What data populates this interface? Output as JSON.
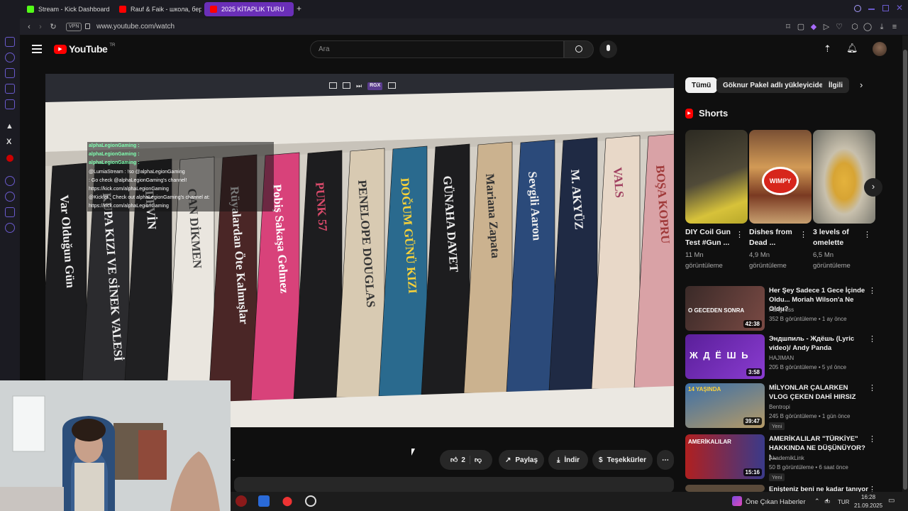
{
  "browser": {
    "tabs": [
      {
        "label": "Stream - Kick Dashboard",
        "color": "#53fc18"
      },
      {
        "label": "Rauf & Faik - школа, бер",
        "color": "#ff0000"
      },
      {
        "label": "2025 KİTAPLIK TURU",
        "color": "#ff0000"
      }
    ],
    "new_tab": "+",
    "vpn": "VPN",
    "url": "www.youtube.com/watch"
  },
  "youtube": {
    "logo": "YouTube",
    "logo_sup": "TR",
    "search_placeholder": "Ara"
  },
  "video": {
    "chat": [
      {
        "user": "alphaLegionGaming :",
        "text": ""
      },
      {
        "user": "alphaLegionGaming :",
        "text": ""
      },
      {
        "user": "alphaLegionGaming :",
        "text": ""
      },
      {
        "user": "",
        "text": "@LumiaStream : !so @alphaLegionGaming"
      },
      {
        "user": "",
        "text": ": Go check @alphaLegionGaming's channel!"
      },
      {
        "user": "",
        "text": "https://kick.com/alphaLegionGaming"
      },
      {
        "user": "",
        "text": "@Kicklet : Check out alphaLegionGaming's channel at:"
      },
      {
        "user": "",
        "text": "https://kick.com/alphaLegionGaming"
      }
    ],
    "books": [
      "Var Olduğun Gün",
      "KUPA KIZI VE SİNEK VALESİ",
      "DEVİN",
      "CAN DİKMEN",
      "Rüyalardan Öte Kalmışlar",
      "Pobiş Sakaşa Gelmez",
      "PUNK 57",
      "PENELOPE DOUGLAS",
      "DOĞUM GÜNÜ KIZI",
      "GÜNAHA DAVET",
      "Mariana Zapata",
      "Sevgili Aaron",
      "M. AKYÜZ",
      "VALS",
      "BOŞA KOPRU"
    ],
    "overlay_label": "RGX"
  },
  "actions": {
    "likes": "2",
    "share": "Paylaş",
    "download": "İndir",
    "thanks": "Teşekkürler"
  },
  "sidebar_right": {
    "chips": [
      "Tümü",
      "Göknur Pakel adlı yükleyiciden",
      "İlgili"
    ],
    "shorts_heading": "Shorts",
    "shorts": [
      {
        "title": "DIY Coil Gun Test #Gun ...",
        "views": "11 Mn görüntüleme"
      },
      {
        "title": "Dishes from Dead ...",
        "views": "4,9 Mn görüntüleme"
      },
      {
        "title": "3 levels of omelette",
        "views": "6,5 Mn görüntüleme"
      }
    ],
    "recs": [
      {
        "title": "Her Şey Sadece 1 Gece İçinde Oldu... Moriah Wilson'a Ne Oldu?",
        "channel": "Pangvoss",
        "meta": "352 B görüntüleme • 1 ay önce",
        "duration": "42:38",
        "thumb_text": "O GECEDEN SONRA",
        "badge": ""
      },
      {
        "title": "Эндшпиль - Ждёшь (Lyric video)/ Andy Panda",
        "channel": "HAJIMAN",
        "meta": "205 B görüntüleme • 5 yıl önce",
        "duration": "3:58",
        "thumb_text": "Ж Д Ё Ш Ь",
        "badge": ""
      },
      {
        "title": "MİLYONLAR ÇALARKEN VLOG ÇEKEN DAHİ HIRSIZ",
        "channel": "Bentropi",
        "meta": "245 B görüntüleme • 1 gün önce",
        "duration": "39:47",
        "thumb_text": "14 YAŞINDA",
        "badge": "Yeni"
      },
      {
        "title": "AMERİKALILAR \"TÜRKİYE\" HAKKINDA NE DÜŞÜNÜYOR? |...",
        "channel": "AkademikLink",
        "meta": "50 B görüntüleme • 6 saat önce",
        "duration": "15:16",
        "thumb_text": "AMERİKALILAR",
        "badge": "Yeni"
      },
      {
        "title": "Enişteniz beni ne kadar tanıyor",
        "channel": "",
        "meta": "",
        "duration": "",
        "thumb_text": "",
        "badge": ""
      }
    ]
  },
  "taskbar": {
    "news": "Öne Çıkan Haberler",
    "lang": "TUR",
    "time": "16:28",
    "date": "21.09.2025"
  }
}
